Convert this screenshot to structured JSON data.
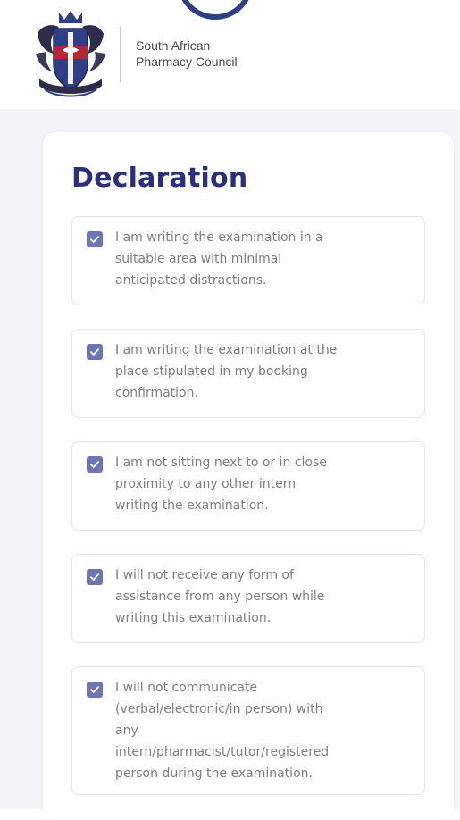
{
  "header": {
    "org_name_line1": "South African",
    "org_name_line2": "Pharmacy Council",
    "logo": "sapc-crest"
  },
  "declaration": {
    "title": "Declaration",
    "items": [
      {
        "text": "I am writing the examination in a\nsuitable area with minimal\nanticipated distractions.",
        "checked": true
      },
      {
        "text": "I am writing the examination at the\nplace stipulated in my booking\nconfirmation.",
        "checked": true
      },
      {
        "text": "I am not sitting next to or in close\nproximity to any other intern\nwriting the examination.",
        "checked": true
      },
      {
        "text": "I will not receive any form of\nassistance from any person while\nwriting this examination.",
        "checked": true
      },
      {
        "text": "I will not communicate\n(verbal/electronic/in person) with\nany\nintern/pharmacist/tutor/registered\nperson during the examination.",
        "checked": true
      }
    ]
  },
  "colors": {
    "title": "#2b2f7c",
    "checkbox": "#6e76b2",
    "item_text": "#7d7d82",
    "background": "#f3f3f8",
    "accent_arc": "#2f3f86"
  },
  "icons": {
    "checkbox": "checkmark-icon",
    "logo": "crest-icon"
  }
}
